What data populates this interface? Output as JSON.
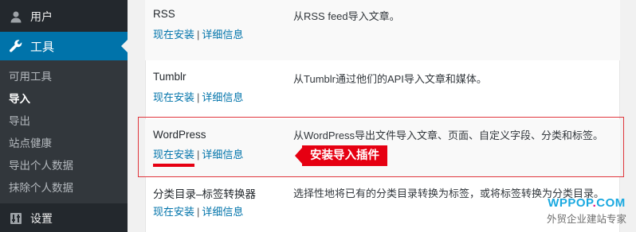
{
  "sidebar": {
    "users_label": "用户",
    "tools_label": "工具",
    "submenu": [
      {
        "label": "可用工具",
        "current": false
      },
      {
        "label": "导入",
        "current": true
      },
      {
        "label": "导出",
        "current": false
      },
      {
        "label": "站点健康",
        "current": false
      },
      {
        "label": "导出个人数据",
        "current": false
      },
      {
        "label": "抹除个人数据",
        "current": false
      }
    ],
    "settings_label": "设置"
  },
  "importers": [
    {
      "name": "RSS",
      "install_label": "现在安装",
      "separator": "|",
      "details_label": "详细信息",
      "description": "从RSS feed导入文章。"
    },
    {
      "name": "Tumblr",
      "install_label": "现在安装",
      "separator": "|",
      "details_label": "详细信息",
      "description": "从Tumblr通过他们的API导入文章和媒体。"
    },
    {
      "name": "WordPress",
      "install_label": "现在安装",
      "separator": "|",
      "details_label": "详细信息",
      "description": "从WordPress导出文件导入文章、页面、自定义字段、分类和标签。"
    },
    {
      "name": "分类目录–标签转换器",
      "install_label": "现在安装",
      "separator": "|",
      "details_label": "详细信息",
      "description": "选择性地将已有的分类目录转换为标签，或将标签转换为分类目录。"
    }
  ],
  "annotation": {
    "callout_text": "安装导入插件",
    "color": "#e60012"
  },
  "watermark": {
    "brand_part1": "WPPOP",
    "brand_dot": ".",
    "brand_part2": "COM",
    "subtitle": "外贸企业建站专家"
  },
  "colors": {
    "sidebar_bg": "#23282d",
    "submenu_bg": "#32373c",
    "active_menu": "#0073aa",
    "link": "#0073aa"
  },
  "icons": {
    "users": "user-icon",
    "tools": "wrench-icon",
    "settings": "settings-sliders-icon"
  }
}
